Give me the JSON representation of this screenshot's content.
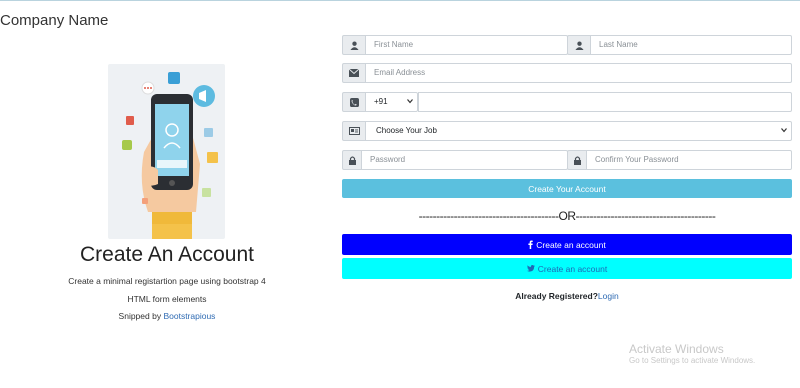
{
  "brand": "Company Name",
  "left": {
    "title": "Create An Account",
    "line1": "Create a minimal registartion page using bootstrap 4",
    "line2": "HTML form elements",
    "snipped_prefix": "Snipped by ",
    "snipped_link": "Bootstrapious"
  },
  "form": {
    "first_name_placeholder": "First Name",
    "last_name_placeholder": "Last Name",
    "email_placeholder": "Email Address",
    "country_code": "+91",
    "phone_value": "",
    "job_selected": "Choose Your Job",
    "password_placeholder": "Password",
    "confirm_password_placeholder": "Confirm Your Password",
    "submit_label": "Create Your Account",
    "or_text": "----------------------------------------OR----------------------------------------",
    "facebook_label": "Create an account",
    "twitter_label": "Create an account",
    "already_label": "Already Registered?",
    "login_label": "Login"
  },
  "watermark": {
    "title": "Activate Windows",
    "subtitle": "Go to Settings to activate Windows."
  },
  "colors": {
    "submit": "#5bc0de",
    "facebook": "#0000ff",
    "twitter": "#00ffff",
    "link": "#2f6bb3"
  },
  "icons": [
    "user-icon",
    "envelope-icon",
    "phone-icon",
    "id-card-icon",
    "lock-icon",
    "facebook-icon",
    "twitter-icon"
  ]
}
